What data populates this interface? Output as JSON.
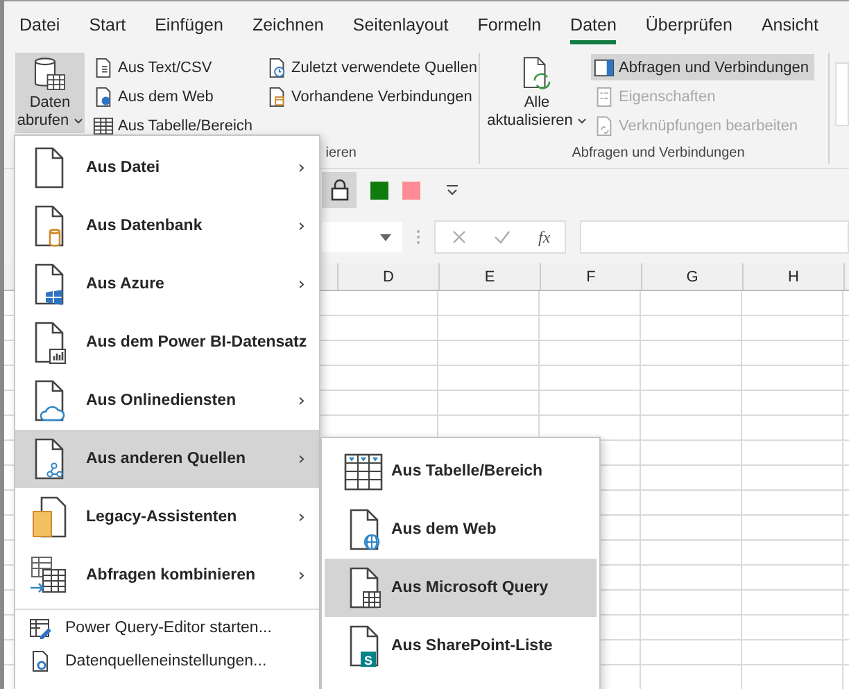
{
  "ribbon_tabs": [
    {
      "label": "Datei",
      "selected": false
    },
    {
      "label": "Start",
      "selected": false
    },
    {
      "label": "Einfügen",
      "selected": false
    },
    {
      "label": "Zeichnen",
      "selected": false
    },
    {
      "label": "Seitenlayout",
      "selected": false
    },
    {
      "label": "Formeln",
      "selected": false
    },
    {
      "label": "Daten",
      "selected": true
    },
    {
      "label": "Überprüfen",
      "selected": false
    },
    {
      "label": "Ansicht",
      "selected": false
    }
  ],
  "get_data_button": {
    "lines": [
      "Daten",
      "abrufen"
    ],
    "selected": true
  },
  "import_buttons": [
    {
      "label": "Aus Text/CSV",
      "kind": "csv"
    },
    {
      "label": "Aus dem Web",
      "kind": "web"
    },
    {
      "label": "Aus Tabelle/Bereich",
      "kind": "table"
    }
  ],
  "source_buttons": [
    {
      "label": "Zuletzt verwendete Quellen",
      "kind": "recent"
    },
    {
      "label": "Vorhandene Verbindungen",
      "kind": "existing"
    }
  ],
  "group_1_label": "ieren",
  "refresh_all_button": {
    "lines": [
      "Alle",
      "aktualisieren"
    ]
  },
  "query_buttons": [
    {
      "label": "Abfragen und Verbindungen",
      "kind": "panel",
      "selected": true,
      "disabled": false
    },
    {
      "label": "Eigenschaften",
      "kind": "properties",
      "selected": false,
      "disabled": true
    },
    {
      "label": "Verknüpfungen bearbeiten",
      "kind": "links",
      "selected": false,
      "disabled": true
    }
  ],
  "group_2_label": "Abfragen und Verbindungen",
  "quick_access": {
    "lock_selected": true,
    "swatches": [
      {
        "color": "#107c10"
      },
      {
        "color": "#ff8c94"
      }
    ]
  },
  "formula_bar": {
    "function_symbol": "fx"
  },
  "columns": [
    "D",
    "E",
    "F",
    "G",
    "H"
  ],
  "menu": {
    "items": [
      {
        "label": "Aus Datei",
        "kind": "file",
        "arrow": "›",
        "selected": false
      },
      {
        "label": "Aus Datenbank",
        "kind": "database",
        "arrow": "›",
        "selected": false
      },
      {
        "label": "Aus Azure",
        "kind": "azure",
        "arrow": "›",
        "selected": false
      },
      {
        "label": "Aus dem Power BI-Datensatz",
        "kind": "powerbi",
        "selected": false
      },
      {
        "label": "Aus Onlinediensten",
        "kind": "online",
        "arrow": "›",
        "selected": false
      },
      {
        "label": "Aus anderen Quellen",
        "kind": "other",
        "arrow": "›",
        "selected": true
      },
      {
        "label": "Legacy-Assistenten",
        "kind": "legacy",
        "arrow": "›",
        "selected": false
      },
      {
        "label": "Abfragen kombinieren",
        "kind": "combine",
        "arrow": "›",
        "selected": false
      }
    ],
    "footer_items": [
      {
        "label": "Power Query-Editor starten...",
        "kind": "editor"
      },
      {
        "label": "Datenquelleneinstellungen...",
        "kind": "settings"
      }
    ]
  },
  "submenu": {
    "items": [
      {
        "label": "Aus Tabelle/Bereich",
        "kind": "table",
        "selected": false
      },
      {
        "label": "Aus dem Web",
        "kind": "web",
        "selected": false
      },
      {
        "label": "Aus Microsoft Query",
        "kind": "query",
        "selected": true
      },
      {
        "label": "Aus SharePoint-Liste",
        "kind": "sharepoint",
        "selected": false,
        "badge": "S"
      }
    ]
  }
}
